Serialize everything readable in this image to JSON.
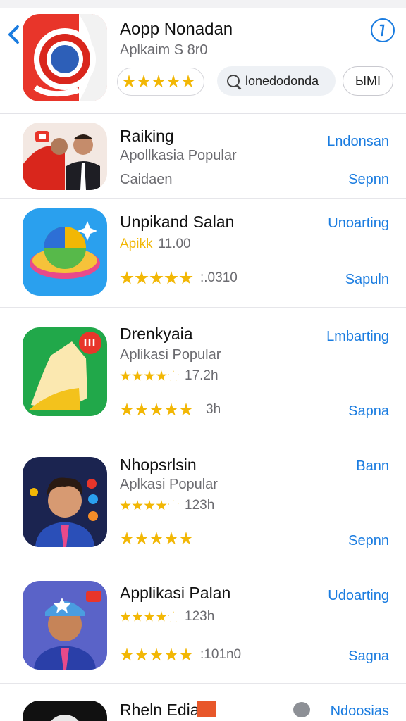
{
  "header": {
    "title": "Aopp Nonadan",
    "subtitle": "Aplkaim S 8r0",
    "search_text": "lonedodonda",
    "button_label": "ЫМI",
    "rating_stars": 5
  },
  "apps": [
    {
      "title": "Raiking",
      "subtitle": "Apollkasia Popular",
      "secondary": "Caidaen",
      "rating_text": "",
      "action_top": "Lndonsan",
      "action_bottom": "Sepnn",
      "stars": 0
    },
    {
      "title": "Unpikand Salan",
      "subtitle": "",
      "secondary": "11.00",
      "secondary_prefix": "Apikk",
      "rating_text": ":.0310",
      "action_top": "Unoarting",
      "action_bottom": "Sapuln",
      "stars": 5
    },
    {
      "title": "Drenkyaia",
      "subtitle": "Aplikasi Popular",
      "secondary": "17.2h",
      "rating_text": "3h",
      "action_top": "Lmbarting",
      "action_bottom": "Sapna",
      "stars": 5
    },
    {
      "title": "Nhopsrlsin",
      "subtitle": "Aplkasi Popular",
      "secondary": "123h",
      "rating_text": "",
      "action_top": "Bann",
      "action_bottom": "Sepnn",
      "stars": 5
    },
    {
      "title": "Applikasi Palan",
      "subtitle": "",
      "secondary": "123h",
      "rating_text": ":101n0",
      "action_top": "Udoarting",
      "action_bottom": "Sagna",
      "stars": 5
    },
    {
      "title": "Rheln Edia",
      "action_top": "Ndoosias"
    }
  ],
  "colors": {
    "accent": "#1a7ce0",
    "star": "#f2b705"
  }
}
